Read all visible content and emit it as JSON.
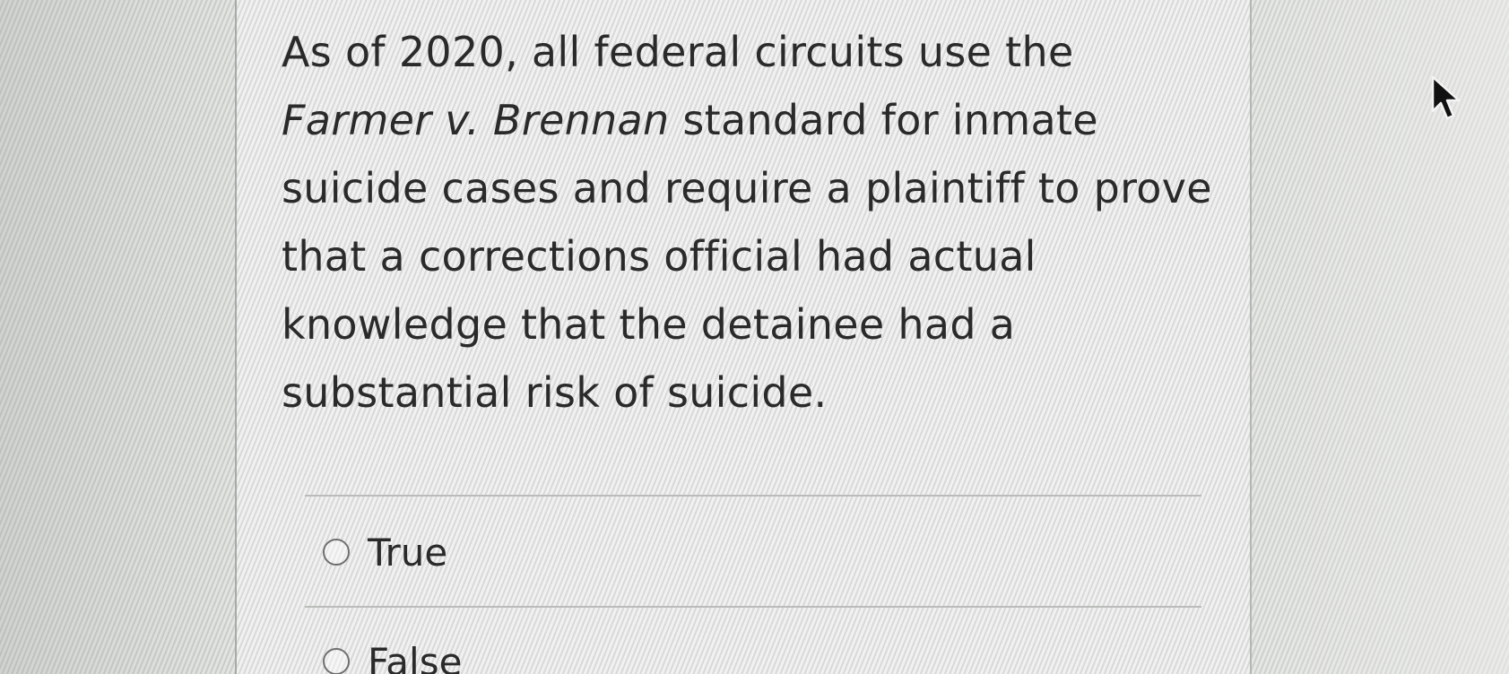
{
  "question": {
    "text_before": "As of 2020, all federal circuits use the ",
    "case_name": "Farmer v. Brennan",
    "text_after": " standard for inmate suicide cases and require a plaintiff to prove that a corrections official had actual knowledge that the detainee had a substantial risk of suicide."
  },
  "options": [
    {
      "label": "True",
      "selected": false
    },
    {
      "label": "False",
      "selected": false
    }
  ],
  "icons": {
    "cursor": "mouse-pointer-icon",
    "radio": "radio-button-icon"
  }
}
